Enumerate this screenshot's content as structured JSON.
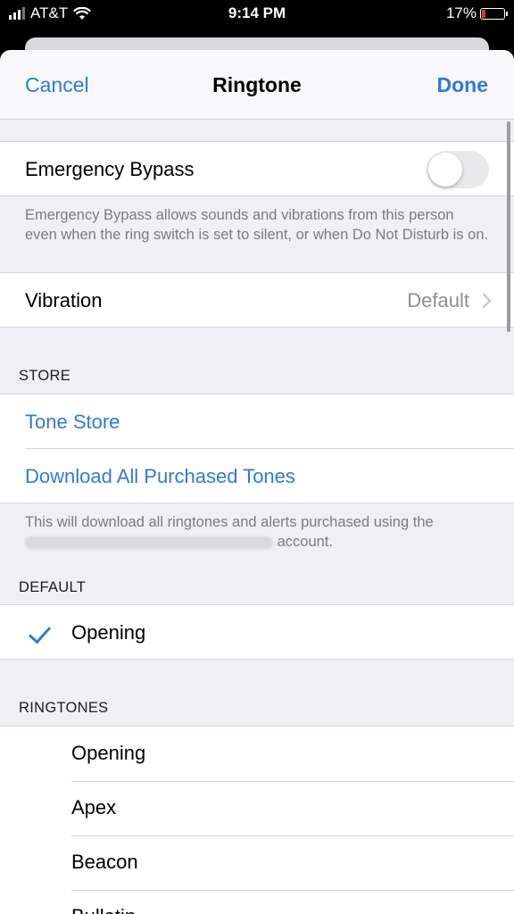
{
  "status": {
    "carrier": "AT&T",
    "time": "9:14 PM",
    "battery": "17%",
    "battery_level": 0.17
  },
  "nav": {
    "cancel": "Cancel",
    "title": "Ringtone",
    "done": "Done"
  },
  "emergency": {
    "label": "Emergency Bypass",
    "enabled": false,
    "footer": "Emergency Bypass allows sounds and vibrations from this person even when the ring switch is set to silent, or when Do Not Disturb is on."
  },
  "vibration": {
    "label": "Vibration",
    "value": "Default"
  },
  "store": {
    "header": "STORE",
    "tone_store": "Tone Store",
    "download_all": "Download All Purchased Tones",
    "footer_prefix": "This will download all ringtones and alerts purchased using the",
    "footer_suffix": "account."
  },
  "default": {
    "header": "DEFAULT",
    "selected": "Opening"
  },
  "ringtones": {
    "header": "RINGTONES",
    "items": [
      "Opening",
      "Apex",
      "Beacon",
      "Bulletin"
    ]
  },
  "colors": {
    "accent": "#2f7bd6",
    "background": "#efeff4",
    "battery_low": "#e23b2e"
  }
}
